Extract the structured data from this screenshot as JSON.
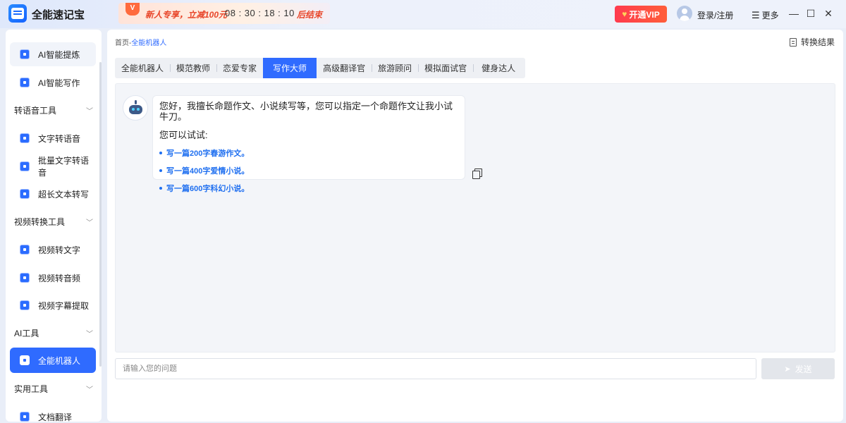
{
  "app": {
    "title": "全能速记宝"
  },
  "promo": {
    "tag": "V",
    "text": "新人专享，立减100元",
    "countdown": "08 : 30 : 18 : 10",
    "end_text": "后结束"
  },
  "header": {
    "vip_label": "开通VIP",
    "login_label": "登录/注册",
    "more_label": "更多"
  },
  "window": {
    "minimize": "—",
    "maximize": "☐",
    "close": "✕"
  },
  "sidebar": {
    "items": [
      {
        "label": "AI智能提炼",
        "icon": "ai-refine-icon"
      },
      {
        "label": "AI智能写作",
        "icon": "ai-write-icon"
      },
      {
        "label": "文字转语音",
        "icon": "text-to-speech-icon"
      },
      {
        "label": "批量文字转语音",
        "icon": "batch-tts-icon"
      },
      {
        "label": "超长文本转写",
        "icon": "long-text-icon"
      },
      {
        "label": "视频转文字",
        "icon": "video-to-text-icon"
      },
      {
        "label": "视频转音频",
        "icon": "video-to-audio-icon"
      },
      {
        "label": "视频字幕提取",
        "icon": "subtitle-extract-icon"
      },
      {
        "label": "全能机器人",
        "icon": "robot-icon"
      },
      {
        "label": "文档翻译",
        "icon": "doc-translate-icon"
      }
    ],
    "groups": [
      {
        "label": "转语音工具"
      },
      {
        "label": "视频转换工具"
      },
      {
        "label": "AI工具"
      },
      {
        "label": "实用工具"
      }
    ],
    "active": "全能机器人"
  },
  "breadcrumb": {
    "home": "首页",
    "separator": "-",
    "current": "全能机器人"
  },
  "toolbar": {
    "switch_result": "转换结果"
  },
  "tabs": [
    {
      "label": "全能机器人"
    },
    {
      "label": "模范教师"
    },
    {
      "label": "恋爱专家"
    },
    {
      "label": "写作大师",
      "active": true
    },
    {
      "label": "高级翻译官"
    },
    {
      "label": "旅游顾问"
    },
    {
      "label": "模拟面试官"
    },
    {
      "label": "健身达人"
    }
  ],
  "chat": {
    "greeting": "您好，我擅长命题作文、小说续写等，您可以指定一个命题作文让我小试牛刀。",
    "try_label": "您可以试试:",
    "suggestions": [
      "写一篇200字春游作文。",
      "写一篇400字爱情小说。",
      "写一篇600字科幻小说。"
    ]
  },
  "input": {
    "placeholder": "请输入您的问题",
    "value": ""
  },
  "send": {
    "label": "发送"
  },
  "colors": {
    "accent": "#2f6bff",
    "vip": "#ff3b4e",
    "promo_red": "#e8462a",
    "link_blue": "#1f6ff0"
  }
}
